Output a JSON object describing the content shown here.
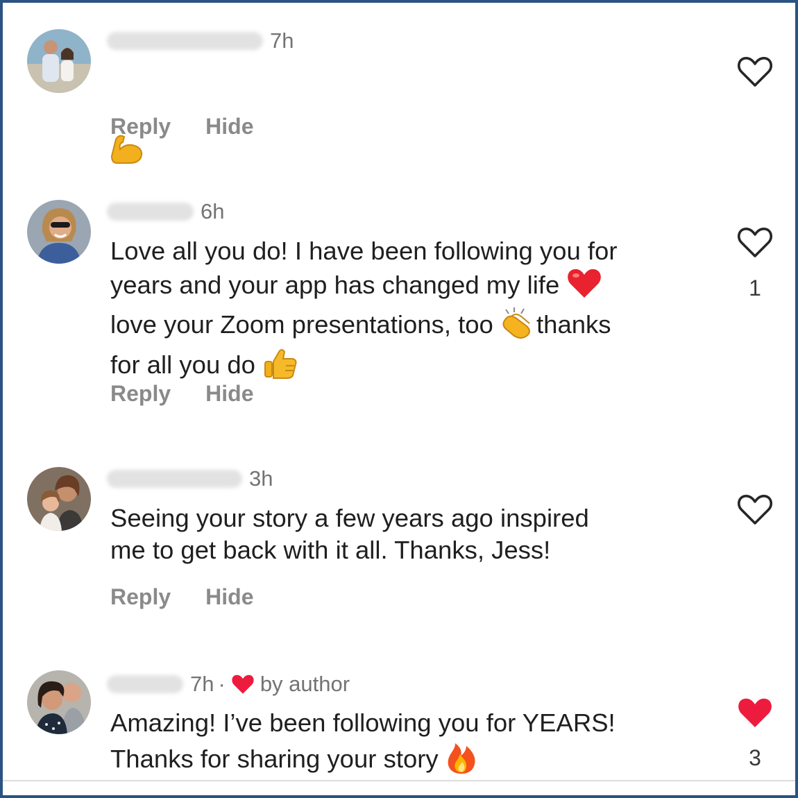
{
  "colors": {
    "frame": "#2a5382",
    "meta_text": "#737373",
    "action_text": "#8a8a8a",
    "liked_heart": "#ed1c3f"
  },
  "actions": {
    "reply": "Reply",
    "hide": "Hide"
  },
  "comments": [
    {
      "username": "hiddenuser1",
      "time": "7h",
      "text": "",
      "emoji": "flexed-biceps",
      "liked": false,
      "like_count": ""
    },
    {
      "username": "hidden2",
      "time": "6h",
      "text_parts": [
        "Love all you do! I have been following you for\nyears and your app has changed my life ",
        "\nlove your Zoom presentations, too ",
        "thanks\nfor all you do "
      ],
      "emojis": [
        "red-heart",
        "clapping-hands",
        "thumbs-up"
      ],
      "liked": false,
      "like_count": "1"
    },
    {
      "username": "hiddenuser3",
      "time": "3h",
      "text": "Seeing your story a few years ago inspired\nme to get back with it all. Thanks, Jess!",
      "liked": false,
      "like_count": ""
    },
    {
      "username": "hidden4",
      "time": "7h",
      "separator": "·",
      "badge": "by author",
      "text": "Amazing! I’ve been following you for YEARS!\nThanks for sharing your story ",
      "emoji": "fire",
      "liked": true,
      "like_count": "3"
    }
  ]
}
